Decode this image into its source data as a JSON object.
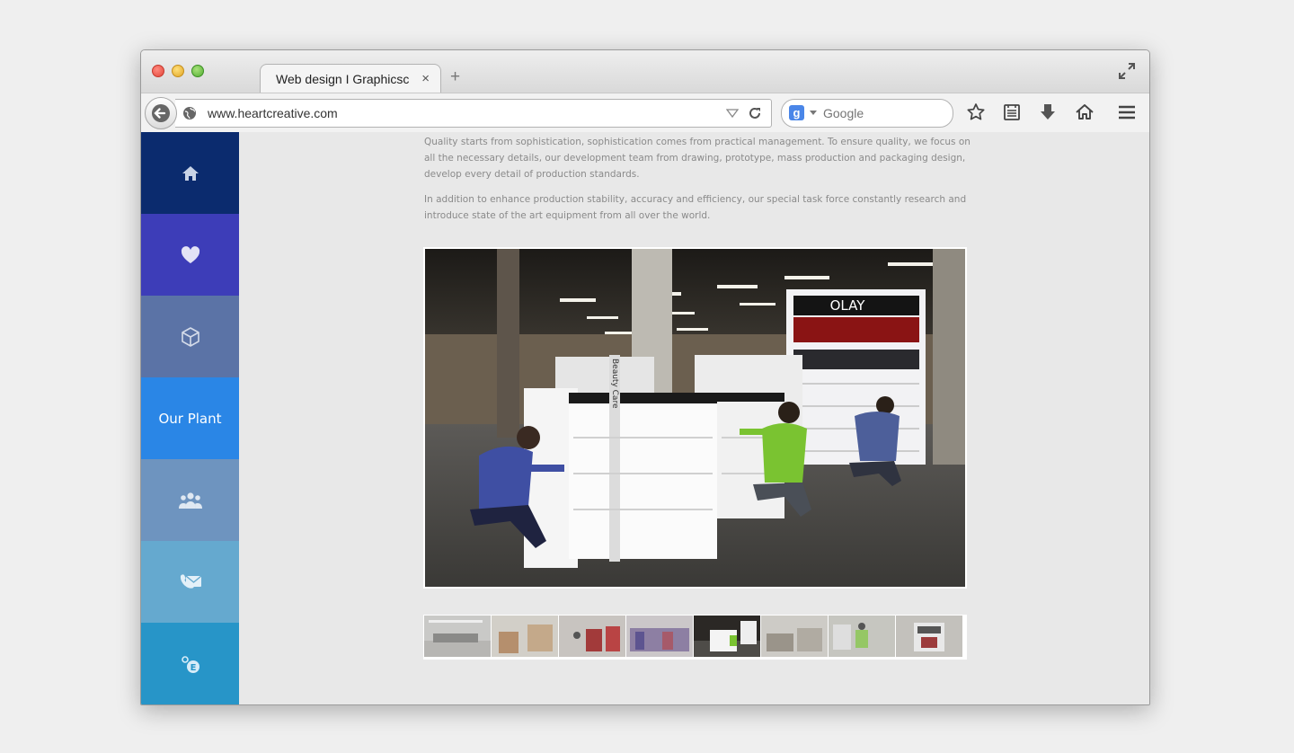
{
  "browser": {
    "tab_title": "Web design I Graphicsc",
    "tab_close": "×",
    "new_tab": "+",
    "url": "www.heartcreative.com",
    "search_engine_badge": "g",
    "search_placeholder": "Google"
  },
  "sidebar": {
    "items": [
      {
        "icon": "home-icon",
        "color": "#0b2b6e"
      },
      {
        "icon": "heart-icon",
        "color": "#3d3db8"
      },
      {
        "icon": "box-icon",
        "color": "#5b73a6"
      },
      {
        "label": "Our Plant",
        "color": "#2a86e6",
        "active": true
      },
      {
        "icon": "team-icon",
        "color": "#6e94bf"
      },
      {
        "icon": "contact-icon",
        "color": "#65a9cf"
      },
      {
        "icon": "language-icon",
        "color": "#2795c8"
      }
    ]
  },
  "main": {
    "paragraphs": [
      "Quality starts from sophistication, sophistication comes from practical management. To ensure quality, we focus on all the necessary details, our development team from drawing, prototype, mass production and packaging design, develop every detail of production standards.",
      "In addition to enhance production stability, accuracy and efficiency, our special task force constantly research and introduce state of the art equipment from all over the world."
    ],
    "photo": {
      "brand_sign": "OLAY",
      "side_panel_text": "Beauty Care"
    },
    "thumbnails_count": 8,
    "selected_thumbnail": 5
  }
}
